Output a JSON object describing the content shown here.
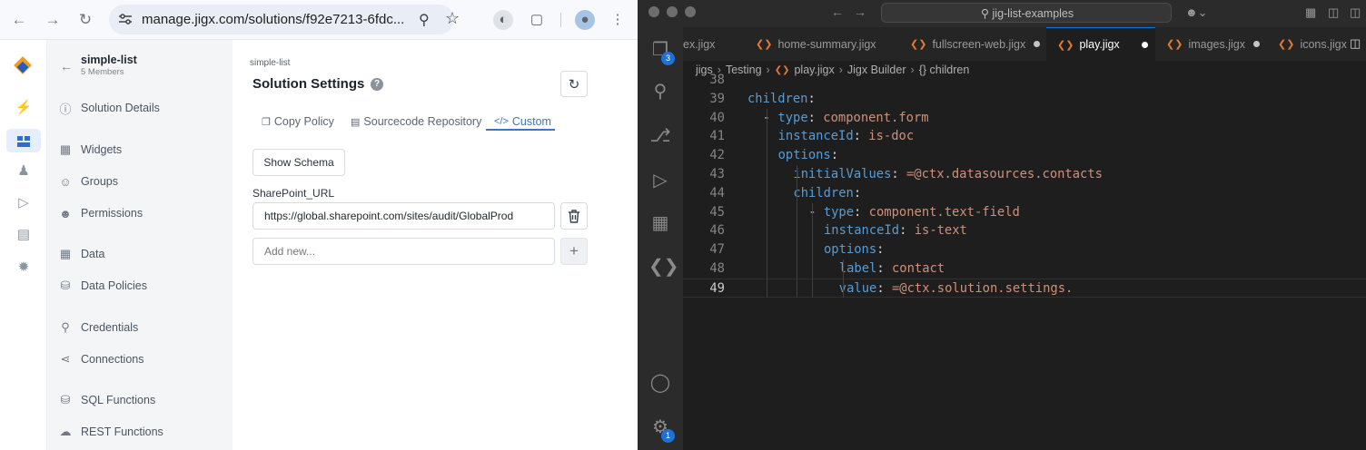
{
  "browser": {
    "url": "manage.jigx.com/solutions/f92e7213-6fdc...",
    "nav": {
      "back_icon": "arrow-left-icon",
      "forward_icon": "arrow-right-icon",
      "reload_icon": "reload-icon"
    }
  },
  "app": {
    "solution_name": "simple-list",
    "members": "5 Members",
    "breadcrumb": "simple-list",
    "page_title": "Solution Settings",
    "sidebar": [
      {
        "label": "Solution Details",
        "icon": "info-icon"
      },
      {
        "label": "Widgets",
        "icon": "widgets-icon"
      },
      {
        "label": "Groups",
        "icon": "groups-icon"
      },
      {
        "label": "Permissions",
        "icon": "permissions-icon"
      },
      {
        "label": "Data",
        "icon": "table-icon"
      },
      {
        "label": "Data Policies",
        "icon": "lock-icon"
      },
      {
        "label": "Credentials",
        "icon": "key-icon"
      },
      {
        "label": "Connections",
        "icon": "share-icon"
      },
      {
        "label": "SQL Functions",
        "icon": "database-icon"
      },
      {
        "label": "REST Functions",
        "icon": "cloud-icon"
      }
    ],
    "tabs": [
      {
        "label": "Copy Policy",
        "active": false
      },
      {
        "label": "Sourcecode Repository",
        "active": false
      },
      {
        "label": "Custom",
        "active": true
      }
    ],
    "show_schema_label": "Show Schema",
    "field_label": "SharePoint_URL",
    "field_value": "https://global.sharepoint.com/sites/audit/GlobalProd",
    "add_new_placeholder": "Add new...",
    "accent_color": "#3b74c8"
  },
  "editor": {
    "search_text": "jig-list-examples",
    "tabs": [
      {
        "label": "ex.jigx",
        "dirty": false
      },
      {
        "label": "home-summary.jigx",
        "dirty": false
      },
      {
        "label": "fullscreen-web.jigx",
        "dirty": true
      },
      {
        "label": "play.jigx",
        "dirty": true,
        "active": true
      },
      {
        "label": "images.jigx",
        "dirty": true
      },
      {
        "label": "icons.jigx",
        "dirty": false
      }
    ],
    "breadcrumbs": [
      "jigs",
      "Testing",
      "play.jigx",
      "Jigx Builder",
      "{} children"
    ],
    "explorer_badge": "3",
    "settings_badge": "1",
    "lines": [
      {
        "n": "38",
        "indent": 0,
        "key": "",
        "sep": "",
        "val": ""
      },
      {
        "n": "39",
        "indent": 0,
        "key": "children",
        "sep": ":",
        "val": ""
      },
      {
        "n": "40",
        "indent": 1,
        "dash": true,
        "key": "type",
        "sep": ":",
        "val": "component.form"
      },
      {
        "n": "41",
        "indent": 2,
        "key": "instanceId",
        "sep": ":",
        "val": "is-doc"
      },
      {
        "n": "42",
        "indent": 2,
        "key": "options",
        "sep": ":",
        "val": ""
      },
      {
        "n": "43",
        "indent": 3,
        "key": "initialValues",
        "sep": ":",
        "val": "=@ctx.datasources.contacts"
      },
      {
        "n": "44",
        "indent": 3,
        "key": "children",
        "sep": ":",
        "val": ""
      },
      {
        "n": "45",
        "indent": 4,
        "dash": true,
        "key": "type",
        "sep": ":",
        "val": "component.text-field"
      },
      {
        "n": "46",
        "indent": 5,
        "key": "instanceId",
        "sep": ":",
        "val": "is-text"
      },
      {
        "n": "47",
        "indent": 5,
        "key": "options",
        "sep": ":",
        "val": ""
      },
      {
        "n": "48",
        "indent": 6,
        "key": "label",
        "sep": ":",
        "val": "contact"
      },
      {
        "n": "49",
        "indent": 6,
        "key": "value",
        "sep": ":",
        "val": "=@ctx.solution.settings."
      }
    ]
  }
}
